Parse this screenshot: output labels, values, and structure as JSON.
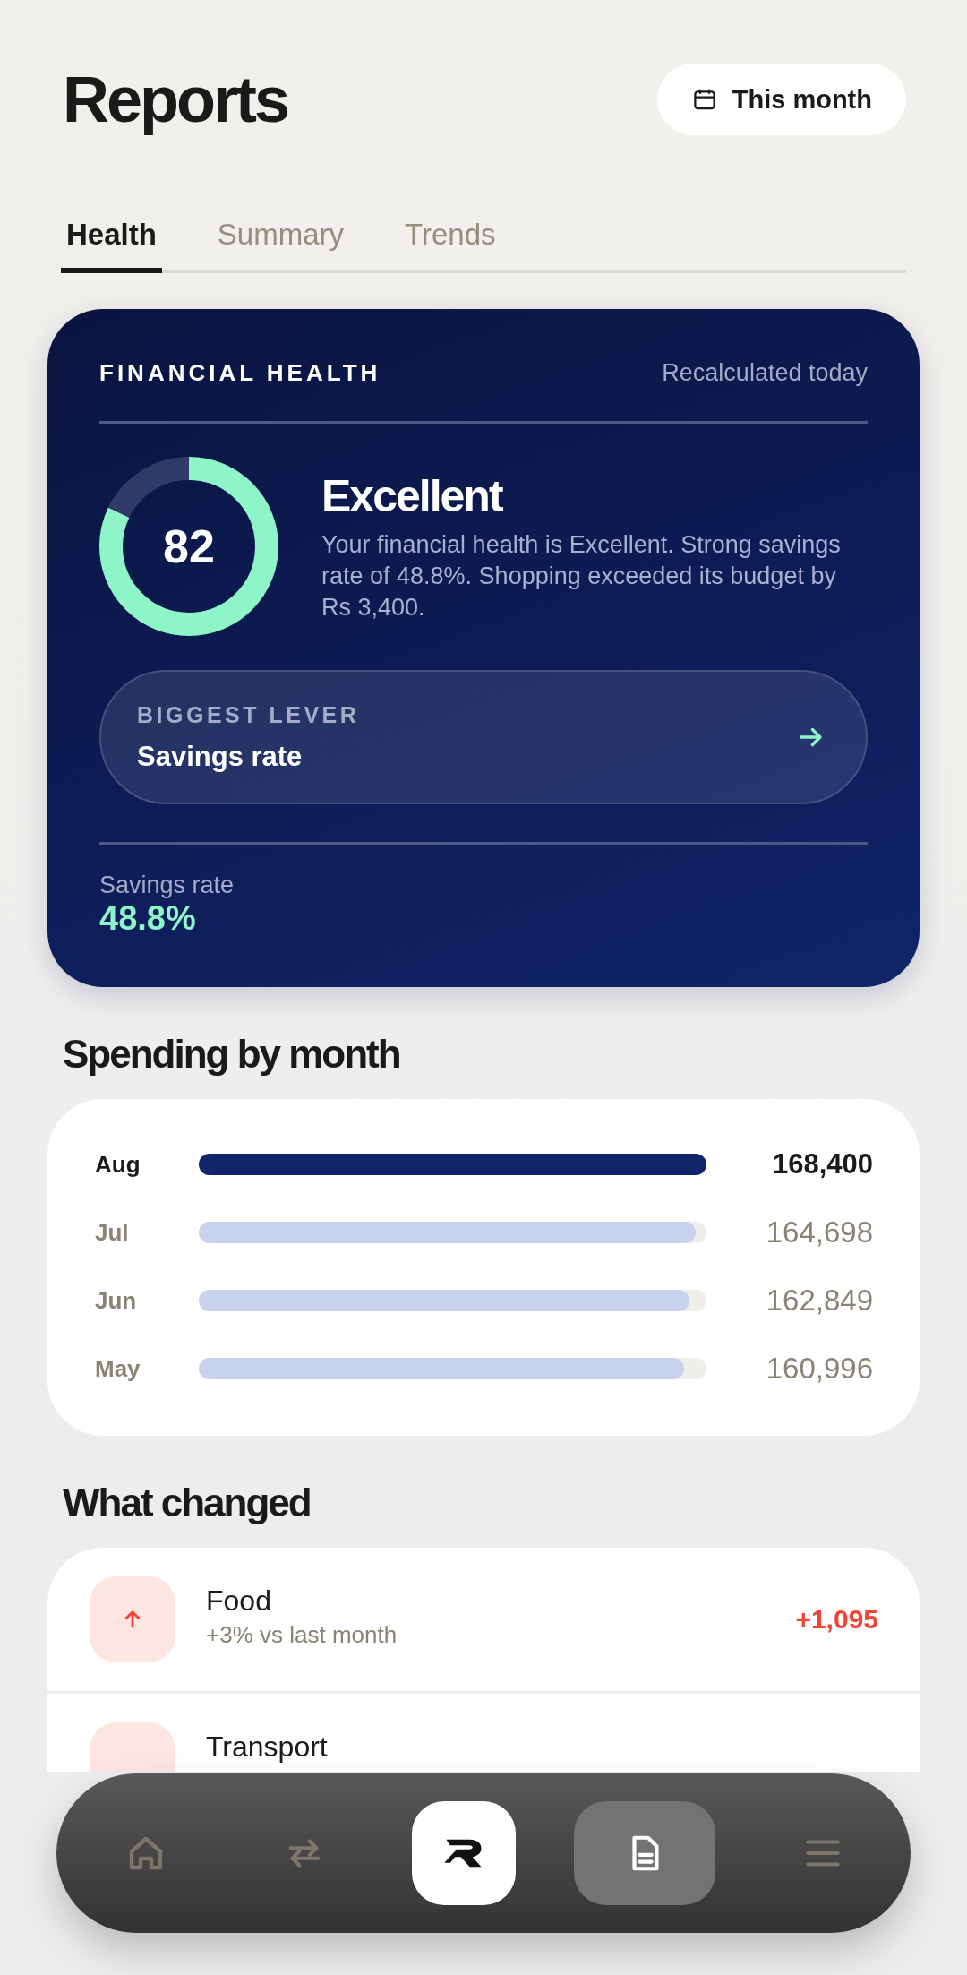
{
  "header": {
    "title": "Reports",
    "period_button": "This month"
  },
  "tabs": [
    {
      "label": "Health",
      "selected": true
    },
    {
      "label": "Summary",
      "selected": false
    },
    {
      "label": "Trends",
      "selected": false
    }
  ],
  "health": {
    "heading": "FINANCIAL HEALTH",
    "updated": "Recalculated today",
    "score": "82",
    "level": 0.82,
    "rating": "Excellent",
    "summary": "Your financial health is Excellent. Strong savings rate of 48.8%. Shopping exceeded its budget by Rs 3,400.",
    "lever": {
      "label": "BIGGEST LEVER",
      "value": "Savings rate"
    },
    "metric": {
      "label": "Savings rate",
      "value": "48.8%"
    }
  },
  "spending": {
    "title": "Spending by month",
    "rows": [
      {
        "month": "Aug",
        "amount": "168,400",
        "level": 1.0,
        "selected": true
      },
      {
        "month": "Jul",
        "amount": "164,698",
        "level": 0.978,
        "selected": false
      },
      {
        "month": "Jun",
        "amount": "162,849",
        "level": 0.967,
        "selected": false
      },
      {
        "month": "May",
        "amount": "160,996",
        "level": 0.956,
        "selected": false
      }
    ]
  },
  "changes": {
    "title": "What changed",
    "items": [
      {
        "name": "Food",
        "detail": "+3% vs last month",
        "amount": "+1,095",
        "kind": "up"
      },
      {
        "name": "Transport"
      }
    ]
  },
  "nav": [
    {
      "kind": "home",
      "selected": false
    },
    {
      "kind": "transfer",
      "selected": false
    },
    {
      "kind": "logo",
      "selected": false
    },
    {
      "kind": "reports",
      "selected": true
    },
    {
      "kind": "menu",
      "selected": false
    }
  ]
}
